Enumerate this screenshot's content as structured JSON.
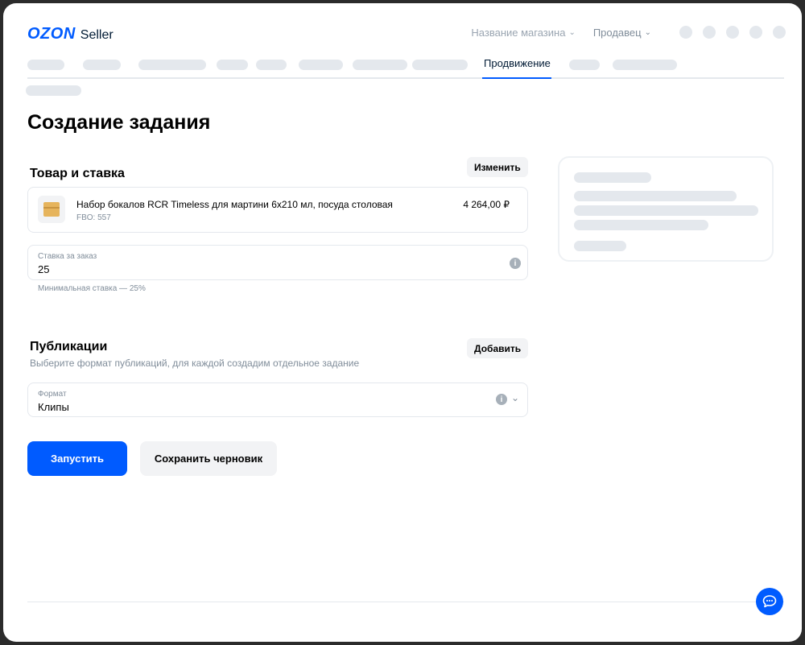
{
  "header": {
    "logo_brand": "OZON",
    "logo_product": "Seller",
    "store_name": "Название магазина",
    "seller": "Продавец"
  },
  "nav": {
    "active_tab": "Продвижение"
  },
  "page": {
    "title": "Создание задания"
  },
  "product_section": {
    "title": "Товар и ставка",
    "change_label": "Изменить",
    "product": {
      "name": "Набор бокалов RCR Timeless для мартини 6х210 мл, посуда столовая",
      "sku": "FBO: 557",
      "price": "4 264,00 ₽",
      "image_text": "OZON"
    },
    "bid_field": {
      "label": "Ставка за заказ",
      "value": "25",
      "hint": "Минимальная ставка — 25%"
    }
  },
  "publications_section": {
    "title": "Публикации",
    "add_label": "Добавить",
    "subtitle": "Выберите формат публикаций, для каждой создадим отдельное задание",
    "format_field": {
      "label": "Формат",
      "value": "Клипы"
    }
  },
  "actions": {
    "launch_label": "Запустить",
    "save_draft_label": "Сохранить черновик"
  },
  "icons": {
    "info": "info-icon",
    "chevron": "chevron-down-icon",
    "chat": "chat-icon"
  },
  "colors": {
    "accent": "#005bff",
    "skeleton": "#e4e8ed",
    "button_secondary": "#f2f3f5"
  }
}
